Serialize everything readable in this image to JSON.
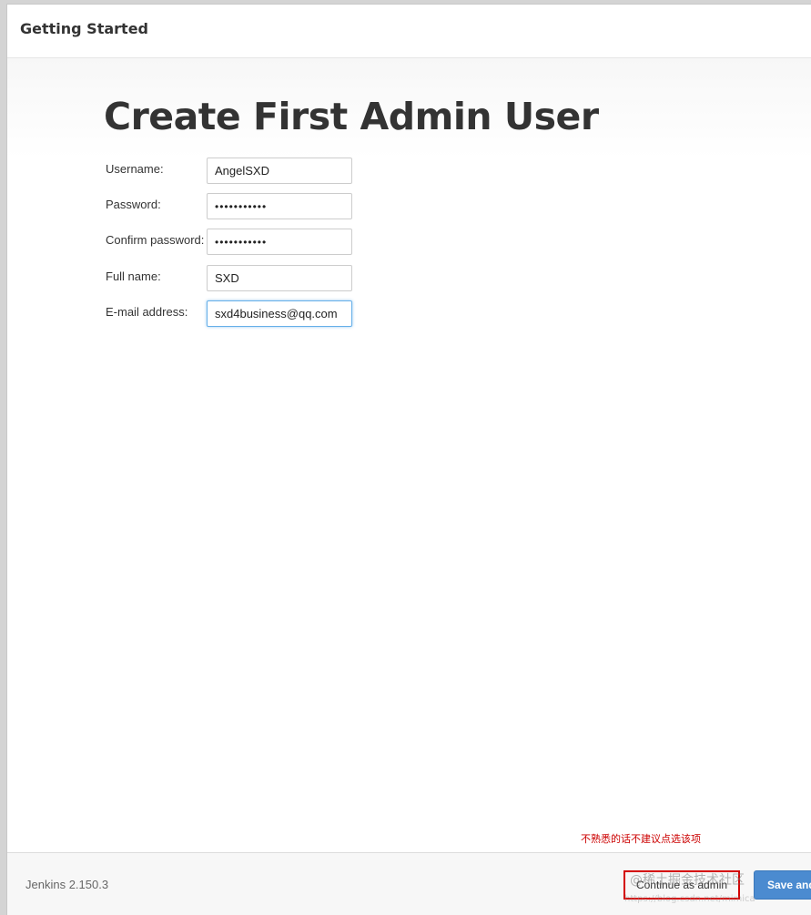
{
  "header": {
    "title": "Getting Started"
  },
  "main": {
    "title": "Create First Admin User",
    "fields": [
      {
        "label": "Username:",
        "value": "AngelSXD"
      },
      {
        "label": "Password:",
        "value": "•••••••••••"
      },
      {
        "label": "Confirm password:",
        "value": "•••••••••••"
      },
      {
        "label": "Full name:",
        "value": "SXD"
      },
      {
        "label": "E-mail address:",
        "value": "sxd4business@qq.com"
      }
    ]
  },
  "footer": {
    "version": "Jenkins 2.150.3",
    "annotation": "不熟悉的话不建议点选该项",
    "continue_label": "Continue as admin",
    "save_label": "Save and Continue"
  },
  "watermark": {
    "text": "@稀土掘金技术社区",
    "url": "https://blog.csdn.net/mimica"
  },
  "colors": {
    "primary_button": "#4b8bd0",
    "annotation_red": "#d40000",
    "focus_border": "#66afe9"
  }
}
